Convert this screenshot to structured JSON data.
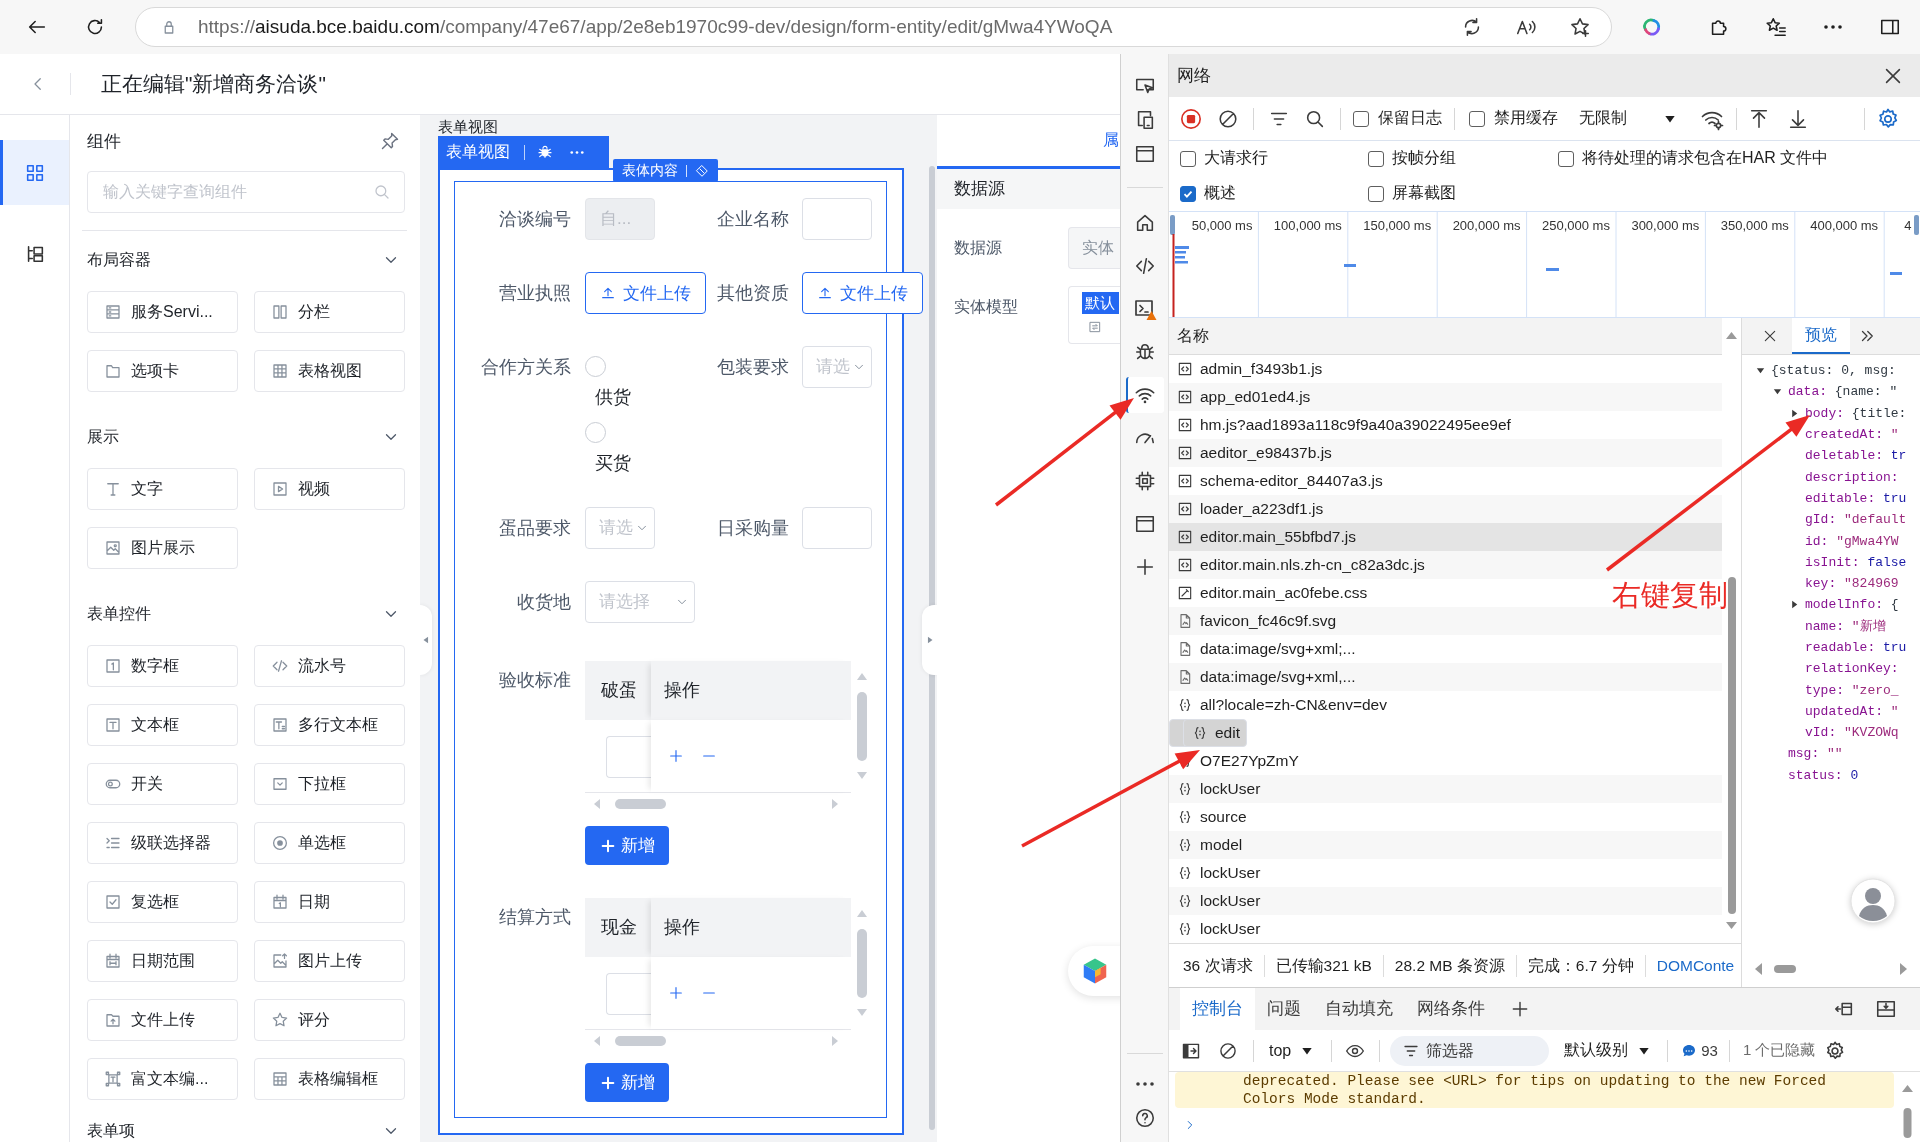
{
  "browser": {
    "url_parts": [
      "https://",
      "aisuda.bce.baidu.com",
      "/company/47e67/app/2e8eb1970c99-dev/design/form-entity/edit/gMwa4YWoQA"
    ]
  },
  "app": {
    "title": "正在编辑\"新增商务洽谈\""
  },
  "rail": [
    {
      "kind": "components",
      "selected": true
    },
    {
      "kind": "outline",
      "selected": false
    }
  ],
  "components": {
    "title": "组件",
    "search": {
      "placeholder": "输入关键字查询组件"
    },
    "groups": [
      {
        "title": "布局容器",
        "expanded": true,
        "items": [
          {
            "label": "服务Servi...",
            "kind": "service"
          },
          {
            "label": "分栏",
            "kind": "columns"
          },
          {
            "label": "选项卡",
            "kind": "tabs"
          },
          {
            "label": "表格视图",
            "kind": "table-view"
          }
        ]
      },
      {
        "title": "展示",
        "expanded": true,
        "items": [
          {
            "label": "文字",
            "kind": "text"
          },
          {
            "label": "视频",
            "kind": "video"
          },
          {
            "label": "图片展示",
            "kind": "image"
          }
        ]
      },
      {
        "title": "表单控件",
        "expanded": true,
        "items": [
          {
            "label": "数字框",
            "kind": "number"
          },
          {
            "label": "流水号",
            "kind": "serial"
          },
          {
            "label": "文本框",
            "kind": "input"
          },
          {
            "label": "多行文本框",
            "kind": "textarea"
          },
          {
            "label": "开关",
            "kind": "switch"
          },
          {
            "label": "下拉框",
            "kind": "select"
          },
          {
            "label": "级联选择器",
            "kind": "cascader"
          },
          {
            "label": "单选框",
            "kind": "radio"
          },
          {
            "label": "复选框",
            "kind": "checkbox"
          },
          {
            "label": "日期",
            "kind": "date"
          },
          {
            "label": "日期范围",
            "kind": "date-range"
          },
          {
            "label": "图片上传",
            "kind": "image-upload"
          },
          {
            "label": "文件上传",
            "kind": "file-upload"
          },
          {
            "label": "评分",
            "kind": "rate"
          },
          {
            "label": "富文本编...",
            "kind": "rich-text"
          },
          {
            "label": "表格编辑框",
            "kind": "table-edit"
          }
        ]
      },
      {
        "title": "表单项",
        "expanded": true
      }
    ]
  },
  "canvas": {
    "caption": "表单视图",
    "toolbar_label": "表单视图",
    "content_tag": "表体内容",
    "rows": [
      {
        "fields": [
          {
            "label": "洽谈编号",
            "kind": "input",
            "placeholder": "自...",
            "disabled": true
          },
          {
            "label": "企业名称",
            "kind": "input",
            "disabled": false
          }
        ]
      },
      {
        "fields": [
          {
            "label": "营业执照",
            "kind": "upload",
            "button": "文件上传"
          },
          {
            "label": "其他资质",
            "kind": "upload",
            "button": "文件上传"
          }
        ]
      },
      {
        "fields": [
          {
            "label": "合作方关系",
            "kind": "radio",
            "options": [
              {
                "label": "供货",
                "selected": false
              },
              {
                "label": "买货",
                "selected": false
              }
            ]
          },
          {
            "label": "包装要求",
            "kind": "select",
            "placeholder": "请选"
          }
        ]
      },
      {
        "fields": [
          {
            "label": "蛋品要求",
            "kind": "select",
            "placeholder": "请选"
          },
          {
            "label": "日采购量",
            "kind": "input",
            "disabled": false
          }
        ]
      },
      {
        "fields": [
          {
            "label": "收货地",
            "kind": "select",
            "placeholder": "请选择"
          }
        ]
      },
      {
        "fields": [
          {
            "label": "验收标准",
            "kind": "table",
            "columns": [
              "破蛋",
              "操作"
            ],
            "add_button": "新增"
          }
        ]
      },
      {
        "fields": [
          {
            "label": "结算方式",
            "kind": "table",
            "columns": [
              "现金",
              "操作"
            ],
            "add_button": "新增"
          }
        ]
      }
    ]
  },
  "properties": {
    "tab": "属",
    "section": "数据源",
    "fields": [
      {
        "label": "数据源",
        "kind": "input",
        "value": "实体"
      },
      {
        "label": "实体模型",
        "kind": "model",
        "tag": "默认"
      }
    ]
  },
  "devtools": {
    "activity_top": [
      {
        "kind": "screencast",
        "selected": false
      },
      {
        "kind": "device",
        "selected": false
      },
      {
        "kind": "window",
        "selected": false
      }
    ],
    "activity": [
      {
        "kind": "home",
        "selected": false
      },
      {
        "kind": "elements",
        "selected": false
      },
      {
        "kind": "console",
        "selected": false
      },
      {
        "kind": "sources",
        "selected": false
      },
      {
        "kind": "network",
        "selected": true
      },
      {
        "kind": "performance",
        "selected": false
      },
      {
        "kind": "memory",
        "selected": false
      },
      {
        "kind": "application",
        "selected": false
      },
      {
        "kind": "add",
        "selected": false
      }
    ],
    "activity_bottom": [
      {
        "kind": "more"
      },
      {
        "kind": "help"
      }
    ],
    "panel_title": "网络",
    "toolbar": {
      "recording": true,
      "checks": [
        {
          "label": "保留日志",
          "checked": false
        },
        {
          "label": "禁用缓存",
          "checked": false
        }
      ],
      "throttle": "无限制"
    },
    "options": [
      {
        "label": "大请求行",
        "checked": false
      },
      {
        "label": "按帧分组",
        "checked": false
      },
      {
        "label": "将待处理的请求包含在HAR 文件中",
        "checked": false
      },
      {
        "label": "概述",
        "checked": true
      },
      {
        "label": "屏幕截图",
        "checked": false
      }
    ],
    "overview": {
      "ticks": [
        "50,000 ms",
        "100,000 ms",
        "150,000 ms",
        "200,000 ms",
        "250,000 ms",
        "300,000 ms",
        "350,000 ms",
        "400,000 ms",
        "4"
      ]
    },
    "requests": {
      "column": "名称",
      "rows": [
        {
          "name": "admin_f3493b1.js",
          "kind": "script",
          "selected": false,
          "hovered": false
        },
        {
          "name": "app_ed01ed4.js",
          "kind": "script",
          "selected": false,
          "hovered": false
        },
        {
          "name": "hm.js?aad1893a118c9f9a40a39022495ee9ef",
          "kind": "script",
          "selected": false,
          "hovered": false
        },
        {
          "name": "aeditor_e98437b.js",
          "kind": "script",
          "selected": false,
          "hovered": false
        },
        {
          "name": "schema-editor_84407a3.js",
          "kind": "script",
          "selected": false,
          "hovered": false
        },
        {
          "name": "loader_a223df1.js",
          "kind": "script",
          "selected": false,
          "hovered": false
        },
        {
          "name": "editor.main_55bfbd7.js",
          "kind": "script",
          "selected": false,
          "hovered": true
        },
        {
          "name": "editor.main.nls.zh-cn_c82a3dc.js",
          "kind": "script",
          "selected": false,
          "hovered": false
        },
        {
          "name": "editor.main_ac0febe.css",
          "kind": "stylesheet",
          "selected": false,
          "hovered": false
        },
        {
          "name": "favicon_fc46c9f.svg",
          "kind": "image",
          "selected": false,
          "hovered": false
        },
        {
          "name": "data:image/svg+xml;...",
          "kind": "image",
          "selected": false,
          "hovered": false
        },
        {
          "name": "data:image/svg+xml,...",
          "kind": "image",
          "selected": false,
          "hovered": false
        },
        {
          "name": "all?locale=zh-CN&env=dev",
          "kind": "fetch",
          "selected": false,
          "hovered": false
        },
        {
          "name": "edit",
          "kind": "fetch",
          "selected": true,
          "hovered": false
        },
        {
          "name": "O7E27YpZmY",
          "kind": "fetch",
          "selected": false,
          "hovered": false
        },
        {
          "name": "lockUser",
          "kind": "fetch",
          "selected": false,
          "hovered": false
        },
        {
          "name": "source",
          "kind": "fetch",
          "selected": false,
          "hovered": false
        },
        {
          "name": "model",
          "kind": "fetch",
          "selected": false,
          "hovered": false
        },
        {
          "name": "lockUser",
          "kind": "fetch",
          "selected": false,
          "hovered": false
        },
        {
          "name": "lockUser",
          "kind": "fetch",
          "selected": false,
          "hovered": false
        },
        {
          "name": "lockUser",
          "kind": "fetch",
          "selected": false,
          "hovered": false
        }
      ]
    },
    "preview": {
      "tabs": [
        {
          "label": "预览",
          "selected": true
        }
      ],
      "tree": [
        {
          "kind": "object",
          "value": "{status: 0, msg:",
          "expanded": true,
          "children": [
            {
              "kind": "object",
              "key": "data:",
              "value": "{name: \"",
              "expanded": true,
              "children": [
                {
                  "kind": "object",
                  "key": "body:",
                  "value": "{title:",
                  "expanded": false
                },
                {
                  "kind": "string",
                  "key": "createdAt:",
                  "value": "\""
                },
                {
                  "kind": "boolean",
                  "key": "deletable:",
                  "value": "tr"
                },
                {
                  "kind": "string",
                  "key": "description:"
                },
                {
                  "kind": "boolean",
                  "key": "editable:",
                  "value": "tru"
                },
                {
                  "kind": "string",
                  "key": "gId:",
                  "value": "\"default"
                },
                {
                  "kind": "string",
                  "key": "id:",
                  "value": "\"gMwa4YW"
                },
                {
                  "kind": "boolean",
                  "key": "isInit:",
                  "value": "false"
                },
                {
                  "kind": "string",
                  "key": "key:",
                  "value": "\"824969"
                },
                {
                  "kind": "object",
                  "key": "modelInfo:",
                  "value": "{",
                  "expanded": false
                },
                {
                  "kind": "string",
                  "key": "name:",
                  "value": "\"新增"
                },
                {
                  "kind": "boolean",
                  "key": "readable:",
                  "value": "tru"
                },
                {
                  "kind": "string",
                  "key": "relationKey:"
                },
                {
                  "kind": "string",
                  "key": "type:",
                  "value": "\"zero_"
                },
                {
                  "kind": "string",
                  "key": "updatedAt:",
                  "value": "\""
                },
                {
                  "kind": "string",
                  "key": "vId:",
                  "value": "\"KVZOWq"
                }
              ]
            },
            {
              "kind": "string",
              "key": "msg:",
              "value": "\"\""
            },
            {
              "kind": "number",
              "key": "status:",
              "value": "0"
            }
          ]
        }
      ]
    },
    "summary": [
      {
        "text": "36 次请求",
        "kind": "stat"
      },
      {
        "text": "已传输321 kB",
        "kind": "stat"
      },
      {
        "text": "28.2 MB 条资源",
        "kind": "stat"
      },
      {
        "text": "完成：6.7 分钟",
        "kind": "stat"
      },
      {
        "text": "DOMConte",
        "kind": "link"
      }
    ],
    "drawer_tabs": [
      {
        "label": "控制台",
        "selected": true
      },
      {
        "label": "问题",
        "selected": false
      },
      {
        "label": "自动填充",
        "selected": false
      },
      {
        "label": "网络条件",
        "selected": false
      }
    ],
    "console_toolbar": {
      "context": "top",
      "filter_placeholder": "筛选器",
      "level": "默认级别",
      "message_count": "93",
      "hidden": "1 个已隐藏"
    },
    "console_messages": [
      {
        "kind": "warning",
        "text": "deprecated. Please see <URL> for tips on updating to the new Forced\nColors Mode standard."
      }
    ]
  },
  "annotation": {
    "text": "右键复制"
  }
}
